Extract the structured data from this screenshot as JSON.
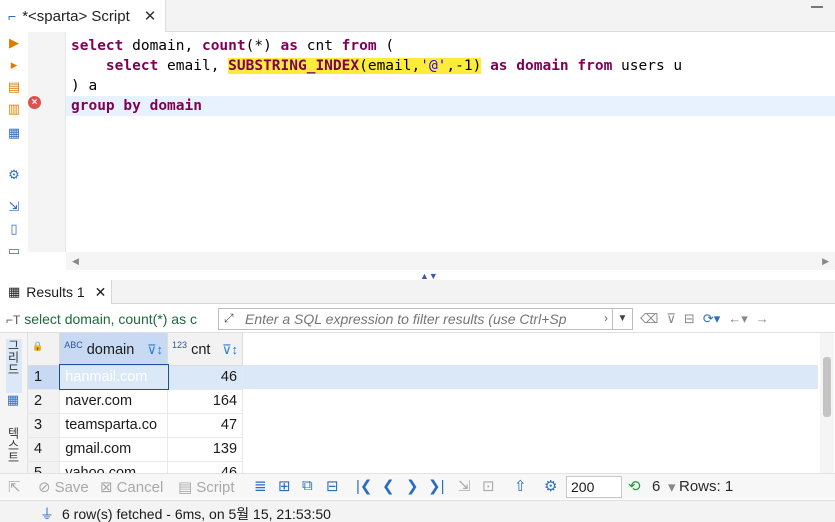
{
  "editor_tab": {
    "title": "*<sparta> Script",
    "close": "✕"
  },
  "sql": {
    "line1": {
      "k1": "select",
      "t1": " domain, ",
      "k2": "count",
      "t2": "(*) ",
      "k3": "as",
      "t3": " cnt ",
      "k4": "from",
      "t4": " ("
    },
    "line2": {
      "k1": "    select",
      "t1": " email, ",
      "fn": "SUBSTRING_INDEX",
      "t2": "(email,",
      "str": "'@'",
      "t3": ",-1)",
      "t4": " ",
      "k2": "as",
      "t5": " ",
      "k3": "domain",
      "t6": " ",
      "k4": "from",
      "t7": " users u"
    },
    "line3": {
      "t1": ") a"
    },
    "line4": {
      "k1": "group",
      "t1": " ",
      "k2": "by",
      "t2": " ",
      "k3": "domain"
    }
  },
  "results_tab": {
    "label": "Results 1",
    "close": "✕"
  },
  "filter": {
    "query_title": "select domain, count(*) as c",
    "placeholder": "Enter a SQL expression to filter results (use Ctrl+Sp"
  },
  "vtabs": {
    "grid": "그리드",
    "text": "텍스트"
  },
  "grid": {
    "columns": [
      {
        "type": "ABC",
        "name": "domain"
      },
      {
        "type": "123",
        "name": "cnt"
      }
    ],
    "rows": [
      {
        "n": "1",
        "domain": "hanmail.com",
        "cnt": "46"
      },
      {
        "n": "2",
        "domain": "naver.com",
        "cnt": "164"
      },
      {
        "n": "3",
        "domain": "teamsparta.co",
        "cnt": "47"
      },
      {
        "n": "4",
        "domain": "gmail.com",
        "cnt": "139"
      },
      {
        "n": "5",
        "domain": "yahoo.com",
        "cnt": "46"
      }
    ]
  },
  "bottom": {
    "save": "Save",
    "cancel": "Cancel",
    "script": "Script",
    "fetch_size": "200",
    "count": "6",
    "rows": "Rows: 1"
  },
  "status": {
    "text": "6 row(s) fetched - 6ms, on 5월 15, 21:53:50"
  },
  "colors": {
    "keyword": "#7f0055",
    "highlight": "#ffeb3b",
    "selection": "#3b78d4"
  }
}
